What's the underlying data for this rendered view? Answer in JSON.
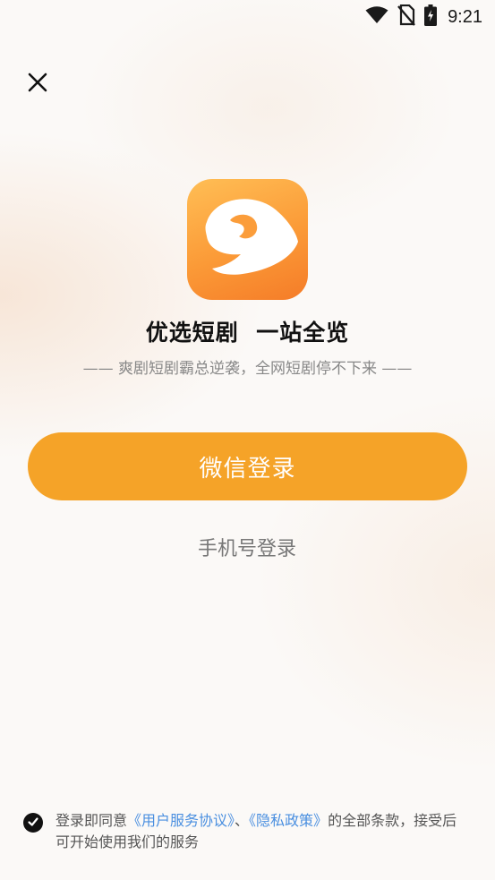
{
  "status_bar": {
    "time": "9:21",
    "icons": [
      "wifi-icon",
      "no-sim-icon",
      "battery-charging-icon"
    ]
  },
  "header": {
    "close_icon": "close-icon"
  },
  "app": {
    "logo_icon": "app-logo-icon",
    "title": "优选短剧  一站全览",
    "subtitle": "—— 爽剧短剧霸总逆袭，全网短剧停不下来 ——"
  },
  "actions": {
    "wechat_login_label": "微信登录",
    "phone_login_label": "手机号登录"
  },
  "agreement": {
    "checked": true,
    "prefix": "登录即同意",
    "user_agreement_link": "《用户服务协议》",
    "separator": "、",
    "privacy_policy_link": "《隐私政策》",
    "suffix": "的全部条款，接受后可开始使用我们的服务"
  },
  "colors": {
    "primary": "#f5a328",
    "link": "#4a8fe0",
    "logo_top": "#ffbe55",
    "logo_bottom": "#f57c28"
  }
}
